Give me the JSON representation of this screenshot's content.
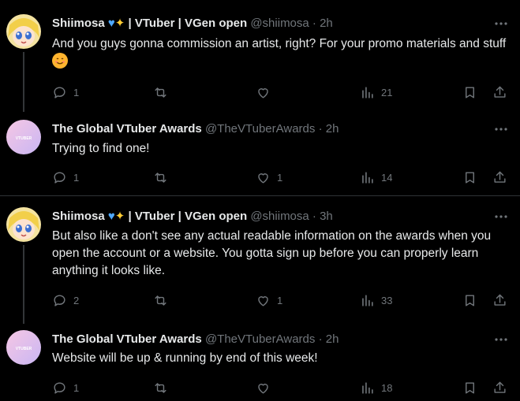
{
  "tweets": [
    {
      "author": "Shiimosa",
      "badges": "| VTuber | VGen open",
      "handle": "@shiimosa",
      "dot": "·",
      "time": "2h",
      "text": "And you guys gonna commission an artist, right? For your promo materials and stuff",
      "emoji": "smiling-face-icon",
      "replies": "1",
      "reposts": "",
      "likes": "",
      "views": "21"
    },
    {
      "author": "The Global VTuber Awards",
      "handle": "@TheVTuberAwards",
      "dot": "·",
      "time": "2h",
      "text": "Trying to find one!",
      "replies": "1",
      "reposts": "",
      "likes": "1",
      "views": "14"
    },
    {
      "author": "Shiimosa",
      "badges": "| VTuber | VGen open",
      "handle": "@shiimosa",
      "dot": "·",
      "time": "3h",
      "text": "But also like a don't see any actual readable information on the awards when you open the account or a website. You gotta sign up before you can properly learn anything it looks like.",
      "replies": "2",
      "reposts": "",
      "likes": "1",
      "views": "33"
    },
    {
      "author": "The Global VTuber Awards",
      "handle": "@TheVTuberAwards",
      "dot": "·",
      "time": "2h",
      "text": "Website will be up & running by end of this week!",
      "replies": "1",
      "reposts": "",
      "likes": "",
      "views": "18"
    }
  ],
  "avatar_text": "VTUBER",
  "colors": {
    "background": "#000000",
    "text": "#e7e9ea",
    "muted": "#71767b",
    "divider": "#2f3336"
  }
}
